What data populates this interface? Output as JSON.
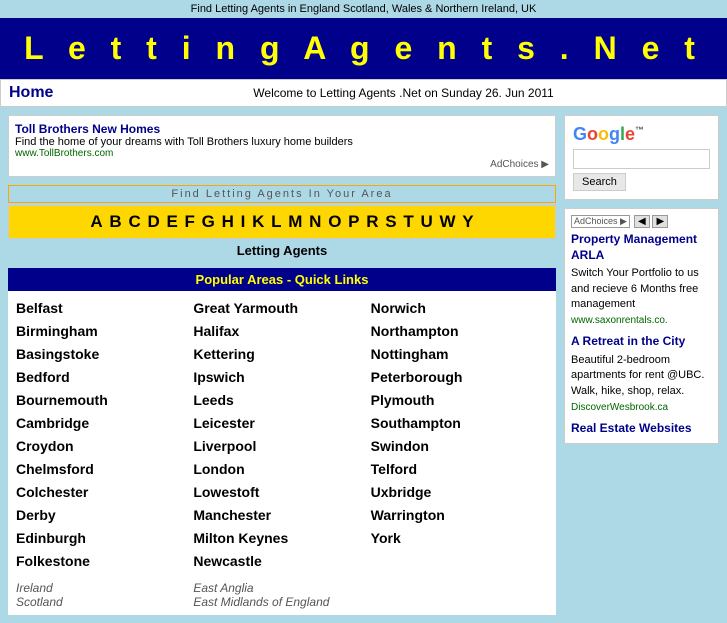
{
  "meta": {
    "top_bar": "Find Letting Agents in England Scotland, Wales & Northern Ireland, UK"
  },
  "header": {
    "title": "L e t t i n g   A g e n t s . N e t"
  },
  "nav": {
    "home_label": "Home",
    "welcome_text": "Welcome to Letting Agents .Net on Sunday 26. Jun 2011"
  },
  "ad_banner": {
    "title": "Toll Brothers New Homes",
    "description": "Find the home of your dreams with Toll Brothers luxury home builders",
    "url": "www.TollBrothers.com",
    "ad_choices": "AdChoices ▶"
  },
  "alphabet_section": {
    "find_label": "Find Letting Agents In Your Area",
    "letters": [
      "A",
      "B",
      "C",
      "D",
      "E",
      "F",
      "G",
      "H",
      "I",
      "K",
      "L",
      "M",
      "N",
      "O",
      "P",
      "R",
      "S",
      "T",
      "U",
      "W",
      "Y"
    ],
    "letting_agents_label": "Letting Agents"
  },
  "popular_areas": {
    "header": "Popular Areas - Quick Links",
    "col1": [
      "Belfast",
      "Birmingham",
      "Basingstoke",
      "Bedford",
      "Bournemouth",
      "Cambridge",
      "Croydon",
      "Chelmsford",
      "Colchester",
      "Derby",
      "Edinburgh",
      "Folkestone"
    ],
    "col2": [
      "Great Yarmouth",
      "Halifax",
      "Kettering",
      "Ipswich",
      "Leeds",
      "Leicester",
      "Liverpool",
      "London",
      "Lowestoft",
      "Manchester",
      "Milton Keynes",
      "Newcastle"
    ],
    "col3": [
      "Norwich",
      "Northampton",
      "Nottingham",
      "Peterborough",
      "Plymouth",
      "Southampton",
      "Swindon",
      "Telford",
      "Uxbridge",
      "Warrington",
      "York",
      ""
    ]
  },
  "regions": {
    "col1": [
      "Ireland",
      "Scotland",
      ""
    ],
    "col2": [
      "East Anglia",
      "East Midlands of England",
      ""
    ]
  },
  "google": {
    "logo": "Google",
    "tm": "™",
    "search_placeholder": "",
    "search_button": "Search"
  },
  "sidebar_ad1": {
    "ad_choices_label": "AdChoices ▶",
    "title": "Property Management ARLA",
    "text": "Switch Your Portfolio to us and recieve 6 Months free management",
    "url": "www.saxonrentals.co."
  },
  "sidebar_ad2": {
    "title": "A Retreat in the City",
    "text": "Beautiful 2-bedroom apartments for rent @UBC. Walk, hike, shop, relax.",
    "url": "DiscoverWesbrook.ca"
  },
  "sidebar_ad3": {
    "title": "Real Estate Websites"
  }
}
